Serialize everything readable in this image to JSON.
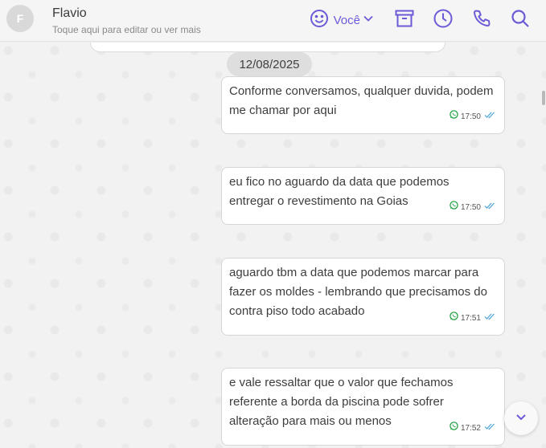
{
  "header": {
    "avatar_initial": "F",
    "contact_name": "Flavio",
    "contact_subtitle": "Toque aqui para editar ou ver mais",
    "user_label": "Você"
  },
  "chat": {
    "date_separator": "12/08/2025",
    "messages": [
      {
        "text": "Conforme conversamos, qualquer duvida, podem me chamar por aqui",
        "time": "17:50",
        "status": "read"
      },
      {
        "text": "eu fico no aguardo da data que podemos entregar o revestimento na Goias",
        "time": "17:50",
        "status": "read"
      },
      {
        "text": "aguardo tbm a data que podemos marcar para fazer os moldes - lembrando que precisamos do contra piso todo acabado",
        "time": "17:51",
        "status": "read"
      },
      {
        "text": "e vale ressaltar que o valor que fechamos referente a borda da piscina pode sofrer alteração para mais ou menos",
        "time": "17:52",
        "status": "read"
      }
    ]
  },
  "icons": {
    "accent_color": "#6b5bd6",
    "header_icons": [
      "smiley-icon",
      "archive-icon",
      "clock-icon",
      "phone-icon",
      "search-icon"
    ],
    "message_source_icon": "whatsapp-icon",
    "message_status_icon": "double-check-icon",
    "scroll_button_icon": "chevron-down-icon"
  },
  "colors": {
    "accent": "#6b5bd6",
    "read_check": "#4aa3d9",
    "whatsapp": "#25a244"
  }
}
